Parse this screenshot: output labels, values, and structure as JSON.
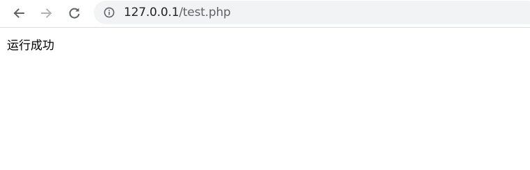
{
  "browser": {
    "nav": {
      "back": {
        "icon": "arrow-left-icon"
      },
      "forward": {
        "icon": "arrow-right-icon",
        "enabled": false
      },
      "reload": {
        "icon": "reload-icon"
      }
    },
    "address_bar": {
      "security_icon": "info-icon",
      "url_host": "127.0.0.1",
      "url_path": "/test.php"
    }
  },
  "page": {
    "message": "运行成功"
  },
  "colors": {
    "toolbar_icon": "#5f6368",
    "toolbar_icon_disabled": "#b0b3b8",
    "omnibox_bg": "#f1f3f4",
    "text": "#000000"
  }
}
